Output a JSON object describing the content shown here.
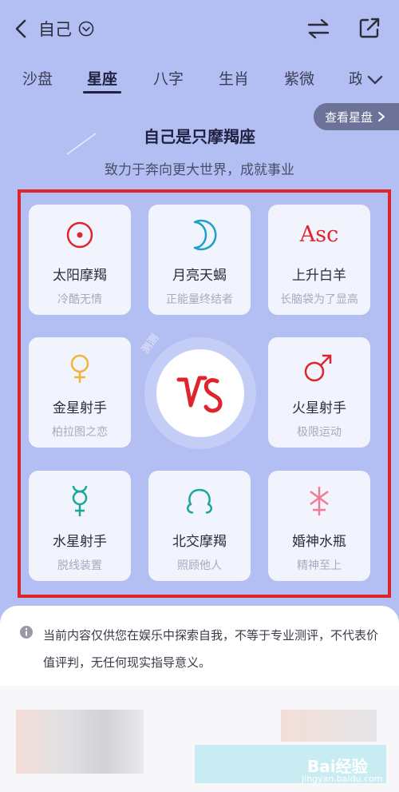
{
  "header": {
    "title": "自己",
    "back_icon": "chevron-left-icon",
    "dropdown_icon": "chevron-down-circle-icon",
    "swap_icon": "swap-arrows-icon",
    "share_icon": "share-out-icon"
  },
  "tabs": [
    {
      "label": "沙盘"
    },
    {
      "label": "星座"
    },
    {
      "label": "八字"
    },
    {
      "label": "生肖"
    },
    {
      "label": "紫微"
    },
    {
      "label": "政"
    }
  ],
  "active_tab": "星座",
  "view_chart_button": "查看星盘",
  "headline": "自己是只摩羯座",
  "subline": "致力于奔向更大世界，成就事业",
  "center": {
    "glyph": "capricorn-icon",
    "watermark": "测测"
  },
  "cards": [
    {
      "name": "太阳摩羯",
      "desc": "冷酷无情",
      "symbol": "sun-icon",
      "color": "#e0242c"
    },
    {
      "name": "月亮天蝎",
      "desc": "正能量终结者",
      "symbol": "moon-icon",
      "color": "#1aa0c9"
    },
    {
      "name": "上升白羊",
      "desc": "长脑袋为了显高",
      "symbol": "Asc",
      "color": "#e0242c"
    },
    {
      "name": "金星射手",
      "desc": "柏拉图之恋",
      "symbol": "venus-icon",
      "color": "#f0b63a"
    },
    {
      "name": "火星射手",
      "desc": "极限运动",
      "symbol": "mars-icon",
      "color": "#e0242c"
    },
    {
      "name": "水星射手",
      "desc": "脱线装置",
      "symbol": "mercury-icon",
      "color": "#1ba79a"
    },
    {
      "name": "北交摩羯",
      "desc": "照顾他人",
      "symbol": "north-node-icon",
      "color": "#1ba79a"
    },
    {
      "name": "婚神水瓶",
      "desc": "精神至上",
      "symbol": "juno-icon",
      "color": "#f07b93"
    }
  ],
  "notice": "当前内容仅供您在娱乐中探索自我，不等于专业测评，不代表价值评判，无任何现实指导意义。",
  "watermark": {
    "brand": "Bai经验",
    "site": "jingyan.baidu.com"
  },
  "colors": {
    "background": "#b3bef2",
    "highlight_frame": "#e0242c",
    "card": "#f2f4fd"
  }
}
